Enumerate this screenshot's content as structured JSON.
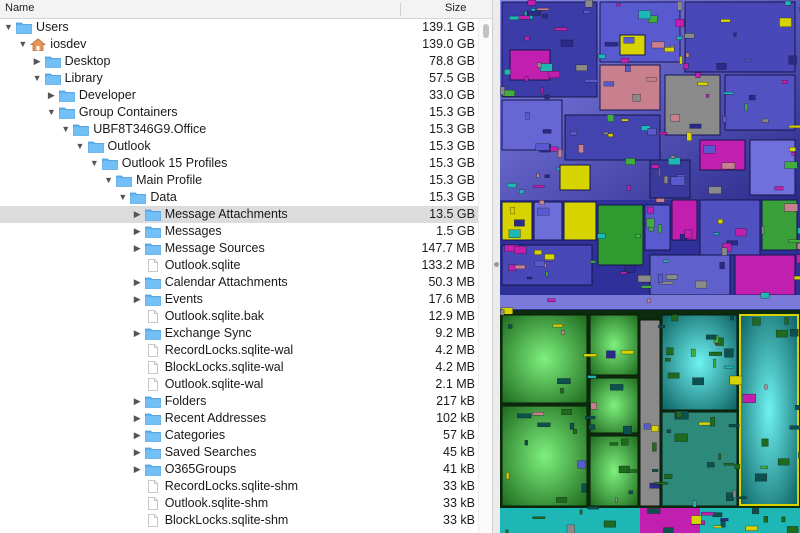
{
  "header": {
    "name_label": "Name",
    "size_label": "Size"
  },
  "tree": [
    {
      "label": "Users",
      "size": "139.1 GB",
      "depth": 0,
      "type": "folder",
      "expanded": true
    },
    {
      "label": "iosdev",
      "size": "139.0 GB",
      "depth": 1,
      "type": "home",
      "expanded": true
    },
    {
      "label": "Desktop",
      "size": "78.8 GB",
      "depth": 2,
      "type": "folder",
      "expanded": false
    },
    {
      "label": "Library",
      "size": "57.5 GB",
      "depth": 2,
      "type": "folder",
      "expanded": true
    },
    {
      "label": "Developer",
      "size": "33.0 GB",
      "depth": 3,
      "type": "folder",
      "expanded": false
    },
    {
      "label": "Group Containers",
      "size": "15.3 GB",
      "depth": 3,
      "type": "folder",
      "expanded": true
    },
    {
      "label": "UBF8T346G9.Office",
      "size": "15.3 GB",
      "depth": 4,
      "type": "folder",
      "expanded": true
    },
    {
      "label": "Outlook",
      "size": "15.3 GB",
      "depth": 5,
      "type": "folder",
      "expanded": true
    },
    {
      "label": "Outlook 15 Profiles",
      "size": "15.3 GB",
      "depth": 6,
      "type": "folder",
      "expanded": true
    },
    {
      "label": "Main Profile",
      "size": "15.3 GB",
      "depth": 7,
      "type": "folder",
      "expanded": true
    },
    {
      "label": "Data",
      "size": "15.3 GB",
      "depth": 8,
      "type": "folder",
      "expanded": true
    },
    {
      "label": "Message Attachments",
      "size": "13.5 GB",
      "depth": 9,
      "type": "folder",
      "expanded": false,
      "selected": true
    },
    {
      "label": "Messages",
      "size": "1.5 GB",
      "depth": 9,
      "type": "folder",
      "expanded": false
    },
    {
      "label": "Message Sources",
      "size": "147.7 MB",
      "depth": 9,
      "type": "folder",
      "expanded": false
    },
    {
      "label": "Outlook.sqlite",
      "size": "133.2 MB",
      "depth": 9,
      "type": "file"
    },
    {
      "label": "Calendar Attachments",
      "size": "50.3 MB",
      "depth": 9,
      "type": "folder",
      "expanded": false
    },
    {
      "label": "Events",
      "size": "17.6 MB",
      "depth": 9,
      "type": "folder",
      "expanded": false
    },
    {
      "label": "Outlook.sqlite.bak",
      "size": "12.9 MB",
      "depth": 9,
      "type": "file"
    },
    {
      "label": "Exchange Sync",
      "size": "9.2 MB",
      "depth": 9,
      "type": "folder",
      "expanded": false
    },
    {
      "label": "RecordLocks.sqlite-wal",
      "size": "4.2 MB",
      "depth": 9,
      "type": "file"
    },
    {
      "label": "BlockLocks.sqlite-wal",
      "size": "4.2 MB",
      "depth": 9,
      "type": "file"
    },
    {
      "label": "Outlook.sqlite-wal",
      "size": "2.1 MB",
      "depth": 9,
      "type": "file"
    },
    {
      "label": "Folders",
      "size": "217 kB",
      "depth": 9,
      "type": "folder",
      "expanded": false
    },
    {
      "label": "Recent Addresses",
      "size": "102 kB",
      "depth": 9,
      "type": "folder",
      "expanded": false
    },
    {
      "label": "Categories",
      "size": "57 kB",
      "depth": 9,
      "type": "folder",
      "expanded": false
    },
    {
      "label": "Saved Searches",
      "size": "45 kB",
      "depth": 9,
      "type": "folder",
      "expanded": false
    },
    {
      "label": "O365Groups",
      "size": "41 kB",
      "depth": 9,
      "type": "folder",
      "expanded": false
    },
    {
      "label": "RecordLocks.sqlite-shm",
      "size": "33 kB",
      "depth": 9,
      "type": "file"
    },
    {
      "label": "Outlook.sqlite-shm",
      "size": "33 kB",
      "depth": 9,
      "type": "file"
    },
    {
      "label": "BlockLocks.sqlite-shm",
      "size": "33 kB",
      "depth": 9,
      "type": "file"
    }
  ],
  "colors": {
    "folder_blue": "#5fb3f2",
    "selection": "#dcdcdc",
    "treemap_blue": "#4a4ab8",
    "treemap_green": "#3fae3f",
    "treemap_magenta": "#c21fb0",
    "treemap_yellow": "#d6d300",
    "treemap_cyan": "#1fb6b6",
    "treemap_gray": "#8a8a8a",
    "treemap_pink": "#c8808e"
  }
}
